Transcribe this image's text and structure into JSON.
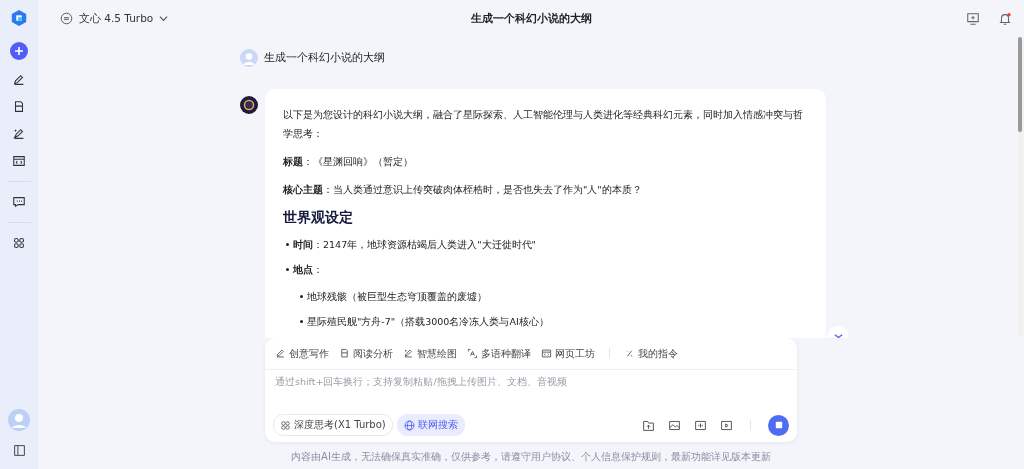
{
  "model": {
    "name": "文心 4.5 Turbo"
  },
  "title": "生成一个科幻小说的大纲",
  "user_message": {
    "text": "生成一个科幻小说的大纲"
  },
  "answer": {
    "paragraphs": [
      "以下是为您设计的科幻小说大纲，融合了星际探索、人工智能伦理与人类进化等经典科幻元素，同时加入情感冲突与哲学思考：",
      "**标题**：《星渊回响》（暂定）",
      "**核心主题**：当人类通过意识上传突破肉体桎梏时，是否也失去了作为\"人\"的本质？"
    ],
    "heading": "世界观设定",
    "items": [
      {
        "text": "**时间**：2147年，地球资源枯竭后人类进入\"大迁徙时代\""
      },
      {
        "text": "**地点**：",
        "children": [
          {
            "text": "地球残骸（被巨型生态穹顶覆盖的废墟）"
          },
          {
            "text": "星际殖民舰\"方舟-7\"（搭载3000名冷冻人类与AI核心）"
          }
        ]
      }
    ]
  },
  "tools": [
    {
      "label": "创意写作",
      "kind": "pen"
    },
    {
      "label": "阅读分析",
      "kind": "doc"
    },
    {
      "label": "智慧绘图",
      "kind": "draw"
    },
    {
      "label": "多语种翻译",
      "kind": "translate"
    },
    {
      "label": "网页工坊",
      "kind": "web"
    },
    {
      "label": "我的指令",
      "kind": "command"
    }
  ],
  "input": {
    "placeholder": "通过shift+回车换行；支持复制粘贴/拖拽上传图片、文档、音视频"
  },
  "options": [
    {
      "label": "深度思考(X1 Turbo)",
      "kind": "think",
      "selected": false
    },
    {
      "label": "联网搜索",
      "kind": "globe",
      "selected": true
    }
  ],
  "footer": "内容由AI生成，无法确保真实准确，仅供参考，请遵守用户协议、个人信息保护规则，最新功能详见版本更新"
}
